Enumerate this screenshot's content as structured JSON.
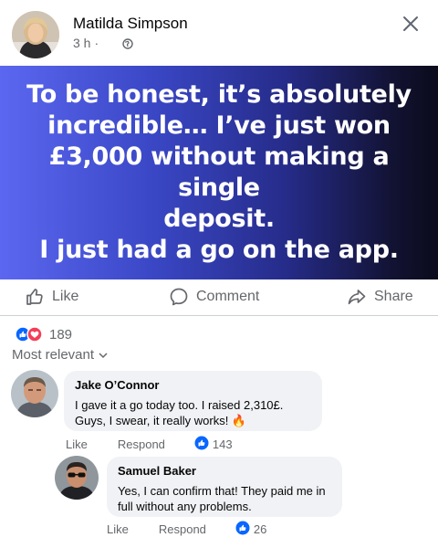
{
  "post": {
    "author": "Matilda Simpson",
    "time": "3 h",
    "separator": "·",
    "banner_text": "To be honest, it’s absolutely\nincredible… I’ve just won\n£3,000 without making a single\ndeposit.\nI just had a go on the app.",
    "banner_colors": [
      "#5b67f0",
      "#262c8a",
      "#0b0b1c"
    ]
  },
  "actions": {
    "like": "Like",
    "comment": "Comment",
    "share": "Share"
  },
  "reactions": {
    "count": "189",
    "icons": [
      "like-icon",
      "love-icon"
    ]
  },
  "sort": {
    "label": "Most relevant"
  },
  "comments": [
    {
      "name": "Jake O’Connor",
      "text": "I gave it a go today too. I raised 2,310£.\nGuys, I swear, it really works! 🔥",
      "like_label": "Like",
      "respond_label": "Respond",
      "likes": "143"
    },
    {
      "name": "Samuel Baker",
      "text": "Yes, I can confirm that! They paid me in\nfull without any problems.",
      "like_label": "Like",
      "respond_label": "Respond",
      "likes": "26"
    }
  ],
  "colors": {
    "accent": "#0866ff",
    "muted": "#65676b",
    "bubble": "#f0f2f5"
  }
}
